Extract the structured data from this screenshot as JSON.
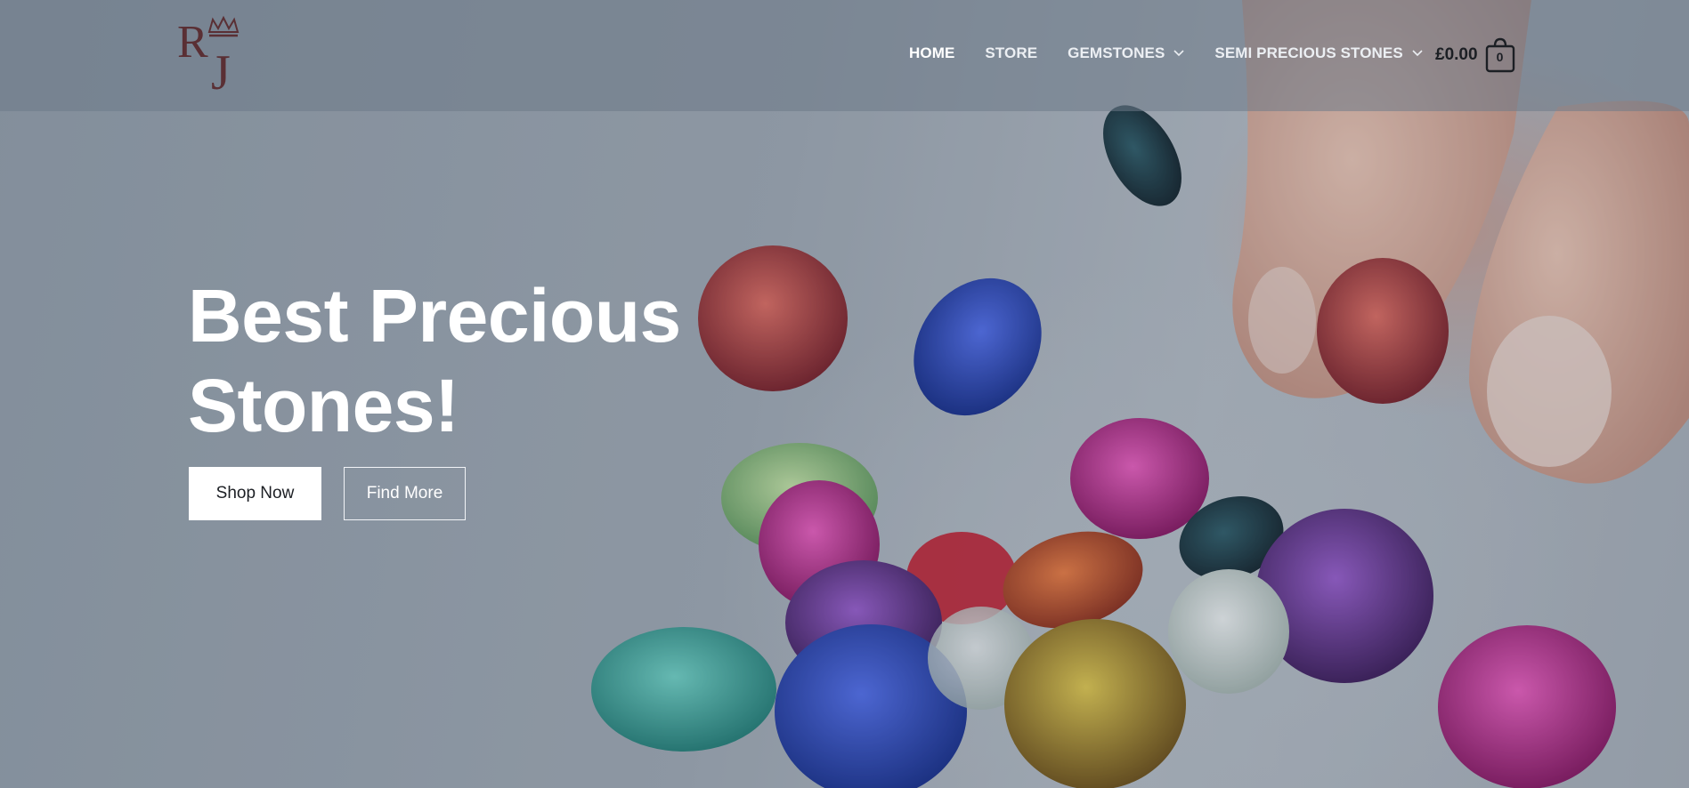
{
  "brand": {
    "logo_text": "RJ",
    "logo_color": "#5a2f34"
  },
  "nav": {
    "items": [
      {
        "label": "HOME",
        "active": true,
        "has_dropdown": false
      },
      {
        "label": "STORE",
        "active": false,
        "has_dropdown": false
      },
      {
        "label": "GEMSTONES",
        "active": false,
        "has_dropdown": true
      },
      {
        "label": "SEMI PRECIOUS STONES",
        "active": false,
        "has_dropdown": true
      }
    ]
  },
  "cart": {
    "total": "£0.00",
    "count": "0",
    "icon": "shopping-bag-icon"
  },
  "hero": {
    "title_line1": "Best Precious",
    "title_line2": "Stones!",
    "primary_button": "Shop Now",
    "secondary_button": "Find More"
  },
  "colors": {
    "header_overlay": "#6e7a88",
    "text_light": "#ffffff",
    "text_dark": "#1c1f24"
  }
}
